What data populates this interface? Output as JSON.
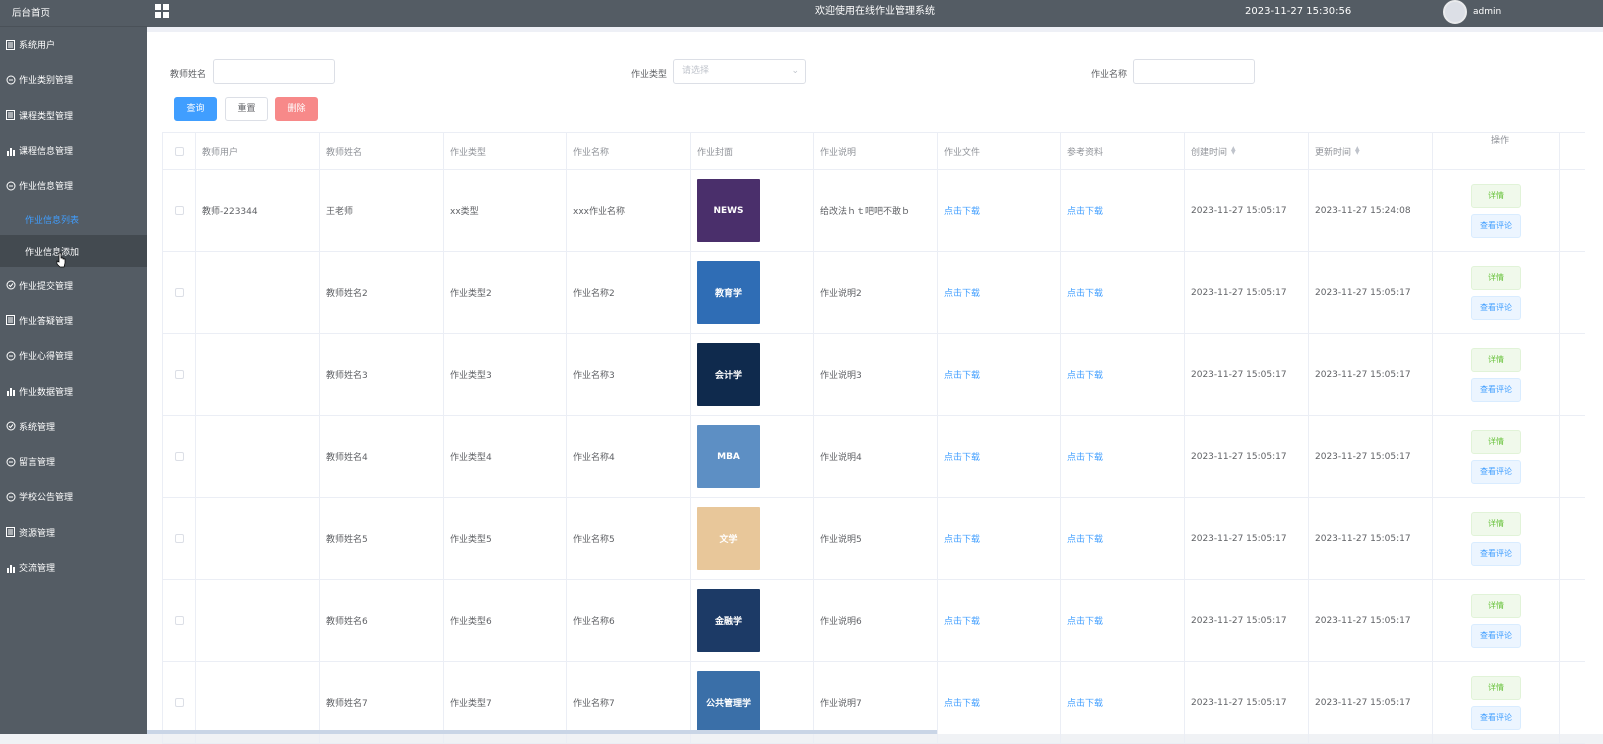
{
  "app": {
    "title": "欢迎使用在线作业管理系统",
    "datetime": "2023-11-27 15:30:56",
    "user": "admin"
  },
  "sidebar": {
    "home": "后台首页",
    "items": [
      {
        "label": "系统用户",
        "icon": "document-icon"
      },
      {
        "label": "作业类别管理",
        "icon": "chat-icon"
      },
      {
        "label": "课程类型管理",
        "icon": "document-icon"
      },
      {
        "label": "课程信息管理",
        "icon": "bar-chart-icon"
      },
      {
        "label": "作业信息管理",
        "icon": "chat-icon"
      }
    ],
    "subitems": [
      {
        "label": "作业信息列表",
        "active": true
      },
      {
        "label": "作业信息添加",
        "active": false
      }
    ],
    "items2": [
      {
        "label": "作业提交管理",
        "icon": "check-circle-icon"
      },
      {
        "label": "作业答疑管理",
        "icon": "document-icon"
      },
      {
        "label": "作业心得管理",
        "icon": "chat-icon"
      },
      {
        "label": "作业数据管理",
        "icon": "bar-chart-icon"
      },
      {
        "label": "系统管理",
        "icon": "check-circle-icon"
      },
      {
        "label": "留言管理",
        "icon": "chat-icon"
      },
      {
        "label": "学校公告管理",
        "icon": "chat-icon"
      },
      {
        "label": "资源管理",
        "icon": "document-icon"
      },
      {
        "label": "交流管理",
        "icon": "bar-chart-icon"
      }
    ]
  },
  "search": {
    "teacher_name_label": "教师姓名",
    "teacher_name_value": "",
    "type_label": "作业类型",
    "type_placeholder": "请选择",
    "name_label": "作业名称",
    "name_value": ""
  },
  "buttons": {
    "query": "查询",
    "reset": "重置",
    "delete": "删除"
  },
  "table": {
    "columns": [
      "教师用户",
      "教师姓名",
      "作业类型",
      "作业名称",
      "作业封面",
      "作业说明",
      "作业文件",
      "参考资料",
      "创建时间",
      "更新时间",
      "操作"
    ],
    "download_label": "点击下载",
    "detail_label": "详情",
    "comment_label": "查看评论",
    "rows": [
      {
        "teacher_user": "教师-223344",
        "teacher_name": "王老师",
        "type": "xx类型",
        "name": "xxx作业名称",
        "cover_text": "NEWS",
        "cover_color": "#4a2f6b",
        "desc": "给改法ｈｔ吧吧不敢ｂ",
        "created": "2023-11-27 15:05:17",
        "updated": "2023-11-27 15:24:08"
      },
      {
        "teacher_user": "",
        "teacher_name": "教师姓名2",
        "type": "作业类型2",
        "name": "作业名称2",
        "cover_text": "教育学",
        "cover_color": "#2f6db5",
        "desc": "作业说明2",
        "created": "2023-11-27 15:05:17",
        "updated": "2023-11-27 15:05:17"
      },
      {
        "teacher_user": "",
        "teacher_name": "教师姓名3",
        "type": "作业类型3",
        "name": "作业名称3",
        "cover_text": "会计学",
        "cover_color": "#0f2a4d",
        "desc": "作业说明3",
        "created": "2023-11-27 15:05:17",
        "updated": "2023-11-27 15:05:17"
      },
      {
        "teacher_user": "",
        "teacher_name": "教师姓名4",
        "type": "作业类型4",
        "name": "作业名称4",
        "cover_text": "MBA",
        "cover_color": "#5d8fc4",
        "desc": "作业说明4",
        "created": "2023-11-27 15:05:17",
        "updated": "2023-11-27 15:05:17"
      },
      {
        "teacher_user": "",
        "teacher_name": "教师姓名5",
        "type": "作业类型5",
        "name": "作业名称5",
        "cover_text": "文学",
        "cover_color": "#e8c79a",
        "desc": "作业说明5",
        "created": "2023-11-27 15:05:17",
        "updated": "2023-11-27 15:05:17"
      },
      {
        "teacher_user": "",
        "teacher_name": "教师姓名6",
        "type": "作业类型6",
        "name": "作业名称6",
        "cover_text": "金融学",
        "cover_color": "#1c3a66",
        "desc": "作业说明6",
        "created": "2023-11-27 15:05:17",
        "updated": "2023-11-27 15:05:17"
      },
      {
        "teacher_user": "",
        "teacher_name": "教师姓名7",
        "type": "作业类型7",
        "name": "作业名称7",
        "cover_text": "公共管理学",
        "cover_color": "#3a6fa8",
        "desc": "作业说明7",
        "created": "2023-11-27 15:05:17",
        "updated": "2023-11-27 15:05:17"
      }
    ]
  }
}
